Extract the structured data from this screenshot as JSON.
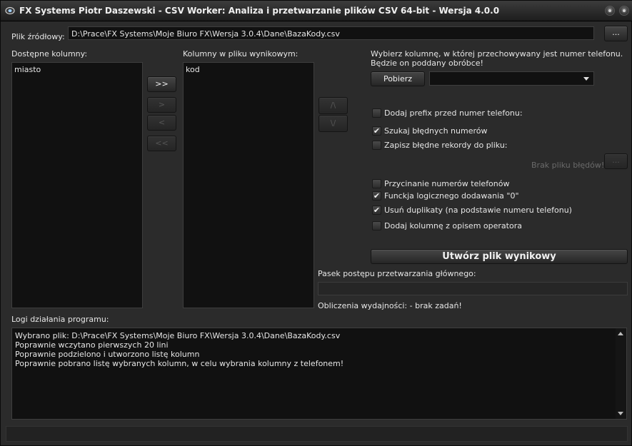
{
  "window": {
    "title": "FX Systems Piotr Daszewski - CSV Worker: Analiza i przetwarzanie plików CSV 64-bit - Wersja 4.0.0"
  },
  "source": {
    "label": "Plik źródłowy:",
    "path": "D:\\Prace\\FX Systems\\Moje Biuro FX\\Wersja 3.0.4\\Dane\\BazaKody.csv",
    "browse_label": "..."
  },
  "available_columns": {
    "label": "Dostępne kolumny:",
    "items": [
      "miasto"
    ]
  },
  "output_columns": {
    "label": "Kolumny w pliku wynikowym:",
    "items": [
      "kod"
    ]
  },
  "transfer_buttons": {
    "add_all": ">>",
    "add": ">",
    "remove": "<",
    "remove_all": "<<"
  },
  "order_buttons": {
    "up": "/\\",
    "down": "\\/"
  },
  "phone": {
    "instruction_line1": "Wybierz kolumnę, w której przechowywany jest numer telefonu.",
    "instruction_line2": "Będzie on poddany obróbce!",
    "fetch_label": "Pobierz",
    "selected": ""
  },
  "options": [
    {
      "label": "Dodaj prefix przed numer telefonu:",
      "checked": false
    },
    {
      "label": "Szukaj błędnych numerów",
      "checked": true
    },
    {
      "label": "Zapisz błędne rekordy do pliku:",
      "checked": false
    },
    {
      "label": "Przycinanie numerów telefonów",
      "checked": false
    },
    {
      "label": "Funckja logicznego dodawania \"0\"",
      "checked": true
    },
    {
      "label": "Usuń duplikaty (na podstawie numeru telefonu)",
      "checked": true
    },
    {
      "label": "Dodaj kolumnę z opisem operatora",
      "checked": false
    }
  ],
  "error_file": {
    "placeholder": "Brak pliku błędów!",
    "browse_label": "..."
  },
  "create_button_label": "Utwórz plik wynikowy",
  "progress": {
    "label": "Pasek postępu przetwarzania głównego:",
    "value": 0
  },
  "performance": {
    "text": "Obliczenia wydajności: - brak zadań!"
  },
  "log": {
    "label": "Logi działania programu:",
    "lines": [
      "Wybrano plik: D:\\Prace\\FX Systems\\Moje Biuro FX\\Wersja 3.0.4\\Dane\\BazaKody.csv",
      "Poprawnie wczytano pierwszych 20 lini",
      "Poprawnie podzielono i utworzono listę kolumn",
      "Poprawnie pobrano listę wybranych kolumn, w celu wybrania kolumny z telefonem!"
    ]
  },
  "icons": {
    "app": "app-icon",
    "minimize": "minimize-icon",
    "close": "close-icon",
    "dropdown": "chevron-down-icon",
    "check": "check-icon"
  }
}
